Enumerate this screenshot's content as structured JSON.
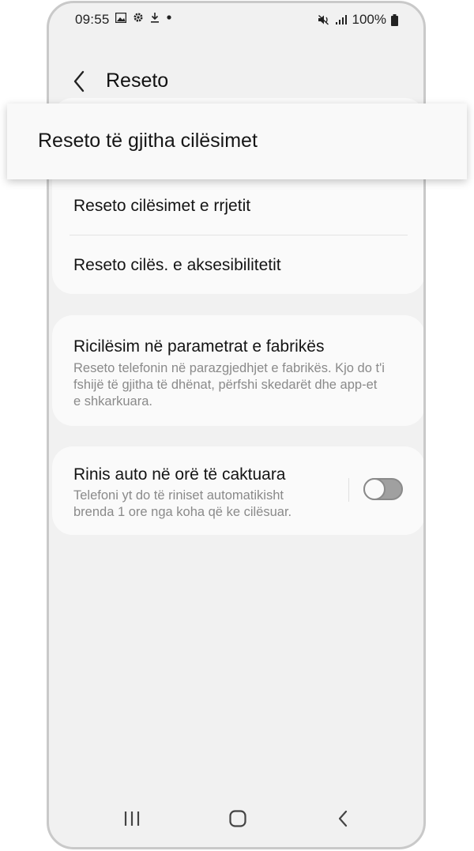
{
  "status_bar": {
    "time": "09:55",
    "left_icons": [
      "gallery-icon",
      "gear-icon",
      "download-icon",
      "dot-icon"
    ],
    "right_icons": [
      "mute-vibrate-icon",
      "signal-icon"
    ],
    "battery_text": "100%"
  },
  "header": {
    "title": "Reseto"
  },
  "highlight": {
    "label": "Reseto të gjitha cilësimet"
  },
  "group1": {
    "items": [
      {
        "title": "Reseto cilësimet e rrjetit"
      },
      {
        "title": "Reseto cilës. e aksesibilitetit"
      }
    ]
  },
  "factory": {
    "title": "Ricilësim në parametrat e fabrikës",
    "subtitle_lines": [
      "Reseto telefonin në parazgjedhjet e fabrikës. Kjo do t'i",
      "fshijë të gjitha të dhënat, përfshi skedarët dhe app-et",
      "e shkarkuara."
    ]
  },
  "auto_restart": {
    "title": "Rinis auto në orë të caktuara",
    "subtitle_lines": [
      "Telefoni yt do të riniset automatikisht",
      "brenda 1 ore nga koha që ke cilësuar."
    ],
    "toggle_on": false
  },
  "nav": {
    "icons": [
      "recents-icon",
      "home-icon",
      "back-nav-icon"
    ]
  },
  "colors": {
    "background": "#f1f1f1",
    "card": "#fafafa",
    "subtitle": "#8a8a8a"
  }
}
